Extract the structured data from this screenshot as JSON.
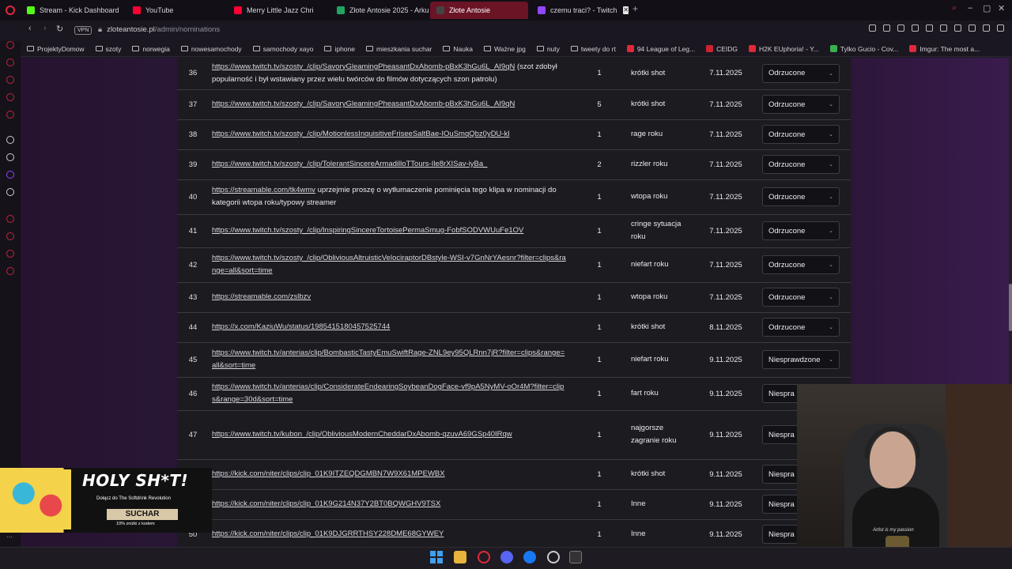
{
  "browser": {
    "tabs": [
      {
        "label": "Stream - Kick Dashboard",
        "color": "#53fc18"
      },
      {
        "label": "YouTube",
        "color": "#ff0033"
      },
      {
        "label": "Merry Little Jazz Chri",
        "color": "#ff0033"
      },
      {
        "label": "Złote Antosie 2025 - Arku",
        "color": "#1fa463"
      },
      {
        "label": "Złote Antosie",
        "color": "#444444",
        "active": true
      },
      {
        "label": "czemu traci? - Twitch",
        "color": "#9146ff"
      }
    ],
    "new_tab": "+",
    "url": "zloteantosie.pl",
    "url_path": "/admin/nominations",
    "vpn": "VPN",
    "bookmarks": [
      {
        "label": "ProjektyDomow",
        "type": "folder"
      },
      {
        "label": "szoty",
        "type": "folder"
      },
      {
        "label": "norwegia",
        "type": "folder"
      },
      {
        "label": "nowesamochody",
        "type": "folder"
      },
      {
        "label": "samochody xayo",
        "type": "folder"
      },
      {
        "label": "iphone",
        "type": "folder"
      },
      {
        "label": "mieszkania suchar",
        "type": "folder"
      },
      {
        "label": "Nauka",
        "type": "folder"
      },
      {
        "label": "Ważne jpg",
        "type": "folder"
      },
      {
        "label": "nuty",
        "type": "folder"
      },
      {
        "label": "tweety do rt",
        "type": "folder"
      },
      {
        "label": "94 League of Leg...",
        "type": "site"
      },
      {
        "label": "CEIDG",
        "type": "site"
      },
      {
        "label": "H2K EUphoria! - Y...",
        "type": "site"
      },
      {
        "label": "Tylko Gucio - Cov...",
        "type": "site"
      },
      {
        "label": "Imgur: The most a...",
        "type": "site"
      }
    ]
  },
  "nominations": [
    {
      "num": "36",
      "link": "https://www.twitch.tv/szosty_/clip/SavoryGleamingPheasantDxAbomb-pBxK3hGu6L_AI9qN",
      "note": " (szot zdobył popularność i był wstawiany przez wielu twórców do filmów dotyczących szon patrolu)",
      "votes": "1",
      "category": "krótki shot",
      "date": "7.11.2025",
      "status": "Odrzucone"
    },
    {
      "num": "37",
      "link": "https://www.twitch.tv/szosty_/clip/SavoryGleamingPheasantDxAbomb-pBxK3hGu6L_AI9qN",
      "note": "",
      "votes": "5",
      "category": "krótki shot",
      "date": "7.11.2025",
      "status": "Odrzucone"
    },
    {
      "num": "38",
      "link": "https://www.twitch.tv/szosty_/clip/MotionlessInquisitiveFriseeSaltBae-IOuSmqQbz0yDU-kl",
      "note": "",
      "votes": "1",
      "category": "rage roku",
      "date": "7.11.2025",
      "status": "Odrzucone"
    },
    {
      "num": "39",
      "link": "https://www.twitch.tv/szosty_/clip/TolerantSincereArmadilloTTours-Ile8rXISav-iyBa_",
      "note": "",
      "votes": "2",
      "category": "rizzler roku",
      "date": "7.11.2025",
      "status": "Odrzucone"
    },
    {
      "num": "40",
      "link": "https://streamable.com/tk4wmv",
      "note": " uprzejmie proszę o wytłumaczenie pominięcia tego klipa w nominacji do kategorii wtopa roku/typowy streamer",
      "votes": "1",
      "category": "wtopa roku",
      "date": "7.11.2025",
      "status": "Odrzucone"
    },
    {
      "num": "41",
      "link": "https://www.twitch.tv/szosty_/clip/InspiringSincereTortoisePermaSmug-FobfSODVWUuFe1OV",
      "note": "",
      "votes": "1",
      "category": "cringe sytuacja roku",
      "date": "7.11.2025",
      "status": "Odrzucone"
    },
    {
      "num": "42",
      "link": "https://www.twitch.tv/szosty_/clip/ObliviousAltruisticVelociraptorDBstyle-WSI-v7GnNrYAesnr?filter=clips&range=all&sort=time",
      "note": "",
      "votes": "1",
      "category": "niefart roku",
      "date": "7.11.2025",
      "status": "Odrzucone"
    },
    {
      "num": "43",
      "link": "https://streamable.com/zslbzv",
      "note": "",
      "votes": "1",
      "category": "wtopa roku",
      "date": "7.11.2025",
      "status": "Odrzucone"
    },
    {
      "num": "44",
      "link": "https://x.com/KaziuWu/status/1985415180457525744",
      "note": "",
      "votes": "1",
      "category": "krótki shot",
      "date": "8.11.2025",
      "status": "Odrzucone"
    },
    {
      "num": "45",
      "link": "https://www.twitch.tv/anterias/clip/BombasticTastyEmuSwiftRage-ZNL9ey95QLRnn7jR?filter=clips&range=all&sort=time",
      "note": "",
      "votes": "1",
      "category": "niefart roku",
      "date": "9.11.2025",
      "status": "Niesprawdzone"
    },
    {
      "num": "46",
      "link": "https://www.twitch.tv/anterias/clip/ConsiderateEndearingSoybeanDogFace-vf9pA5NyMV-oOr4M?filter=clips&range=30d&sort=time",
      "note": "",
      "votes": "1",
      "category": "fart roku",
      "date": "9.11.2025",
      "status": "Niespra"
    },
    {
      "num": "47",
      "link": "https://www.twitch.tv/kubon_/clip/ObliviousModernCheddarDxAbomb-qzuvA69GSp40IRqw",
      "note": "",
      "votes": "1",
      "category": "najgorsze zagranie roku",
      "date": "9.11.2025",
      "status": "Niespra"
    },
    {
      "num": "",
      "link": "https://kick.com/niter/clips/clip_01K9ITZEQDGMBN7W9X61MPEWBX",
      "note": "",
      "votes": "1",
      "category": "krótki shot",
      "date": "9.11.2025",
      "status": "Niespra"
    },
    {
      "num": "",
      "link": "https://kick.com/niter/clips/clip_01K9G214N37Y2BT0BQWGHV9TSX",
      "note": "",
      "votes": "1",
      "category": "Inne",
      "date": "9.11.2025",
      "status": "Niespra"
    },
    {
      "num": "50",
      "link": "https://kick.com/niter/clips/clip_01K9DJGRRTHSY228DME68GYWEY",
      "note": "",
      "votes": "1",
      "category": "Inne",
      "date": "9.11.2025",
      "status": "Niespra"
    }
  ],
  "promo": {
    "title": "HOLY SH*T!",
    "subtitle": "Dołącz do The Softdrink Revolution",
    "code": "SUCHAR",
    "discount": "10% zniżki z kodem"
  },
  "webcam": {
    "shirt_text": "Artist is my passion"
  }
}
